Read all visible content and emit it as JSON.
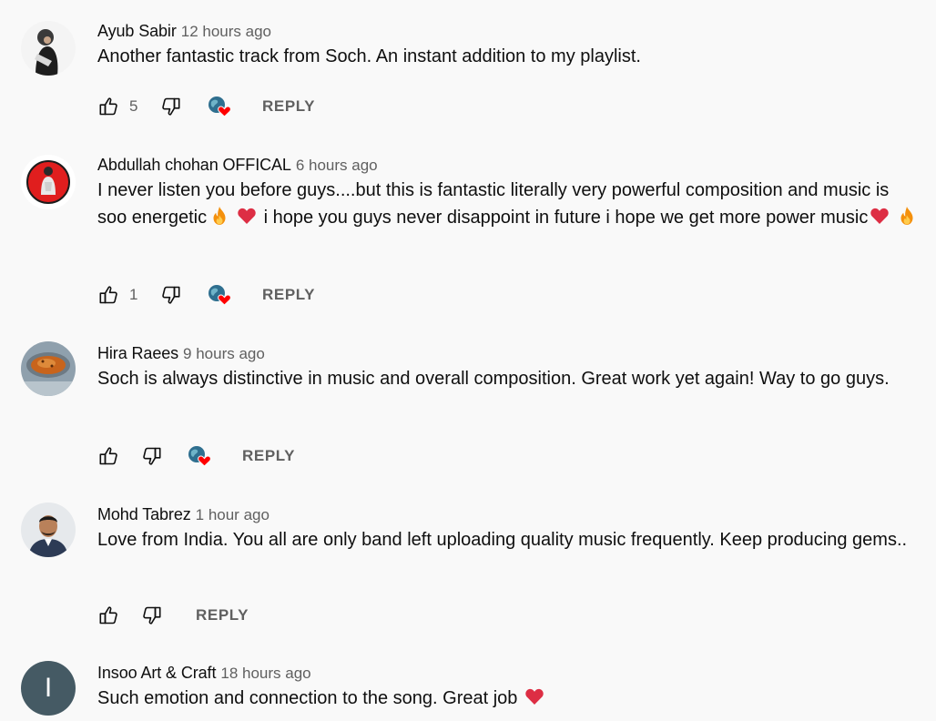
{
  "comments": [
    {
      "author": "Ayub Sabir",
      "time": "12 hours ago",
      "text": "Another fantastic track from Soch. An instant addition to my playlist.",
      "likes": "5",
      "hearted": true,
      "reply_label": "REPLY"
    },
    {
      "author": "Abdullah chohan OFFICAL",
      "time": "6 hours ago",
      "text_parts": [
        "I never listen you before guys....but this is fantastic literally very powerful composition and music is soo energetic",
        " i hope you guys never disappoint in future i hope we get more power music"
      ],
      "likes": "1",
      "hearted": true,
      "reply_label": "REPLY"
    },
    {
      "author": "Hira Raees",
      "time": "9 hours ago",
      "text": "Soch is always distinctive in music and overall composition. Great work yet again! Way to go guys.",
      "likes": "",
      "hearted": true,
      "reply_label": "REPLY"
    },
    {
      "author": "Mohd Tabrez",
      "time": "1 hour ago",
      "text": "Love from India. You all are only band left uploading quality music frequently. Keep producing gems..",
      "likes": "",
      "hearted": false,
      "reply_label": "REPLY"
    },
    {
      "author": "Insoo Art & Craft",
      "time": "18 hours ago",
      "text": "Such emotion and connection to the song. Great job",
      "avatar_letter": "I",
      "avatar_color": "#455a64"
    }
  ],
  "icons": {
    "like": "thumb-up-outline",
    "dislike": "thumb-down-outline",
    "creator_heart": "creator-heart-badge",
    "fire": "fire-emoji",
    "red_heart": "red-heart-emoji"
  },
  "colors": {
    "background": "#f9f9f9",
    "text_primary": "#0f0f0f",
    "text_secondary": "#606060",
    "heart": "#ff0000"
  }
}
